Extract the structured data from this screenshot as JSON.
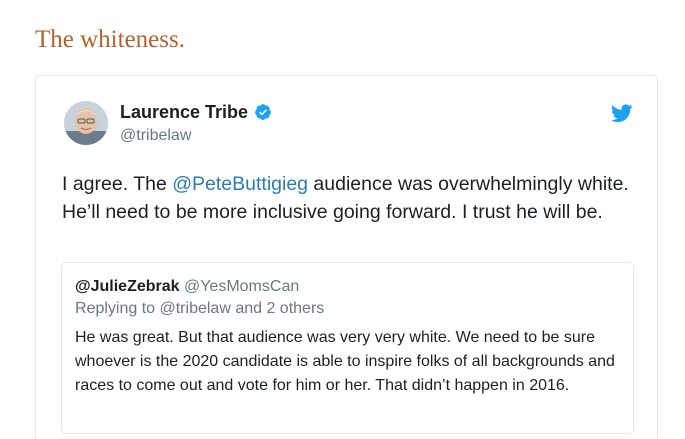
{
  "heading": "The whiteness.",
  "tweet": {
    "author_name": "Laurence Tribe",
    "author_handle": "@tribelaw",
    "verified_icon": "verified-badge-icon",
    "brand_icon": "twitter-bird-icon",
    "text_before_mention": "I agree. The ",
    "mention": "@PeteButtigieg",
    "text_after_mention": " audience was overwhelmingly white. He’ll need to be more inclusive going forward. I trust he will be.",
    "colors": {
      "mention": "#2b7bb9",
      "verified": "#1da1f2",
      "twitter": "#1da1f2"
    }
  },
  "quoted_tweet": {
    "author_name": "@JulieZebrak",
    "author_handle": "@YesMomsCan",
    "reply_context": "Replying to @tribelaw and 2 others",
    "text": "He was great. But that audience was very very white. We need to be sure whoever is the 2020 candidate is able to inspire folks of all backgrounds and races to come out and vote for him or her. That didn’t happen in 2016."
  },
  "heading_color": "#b5632e"
}
